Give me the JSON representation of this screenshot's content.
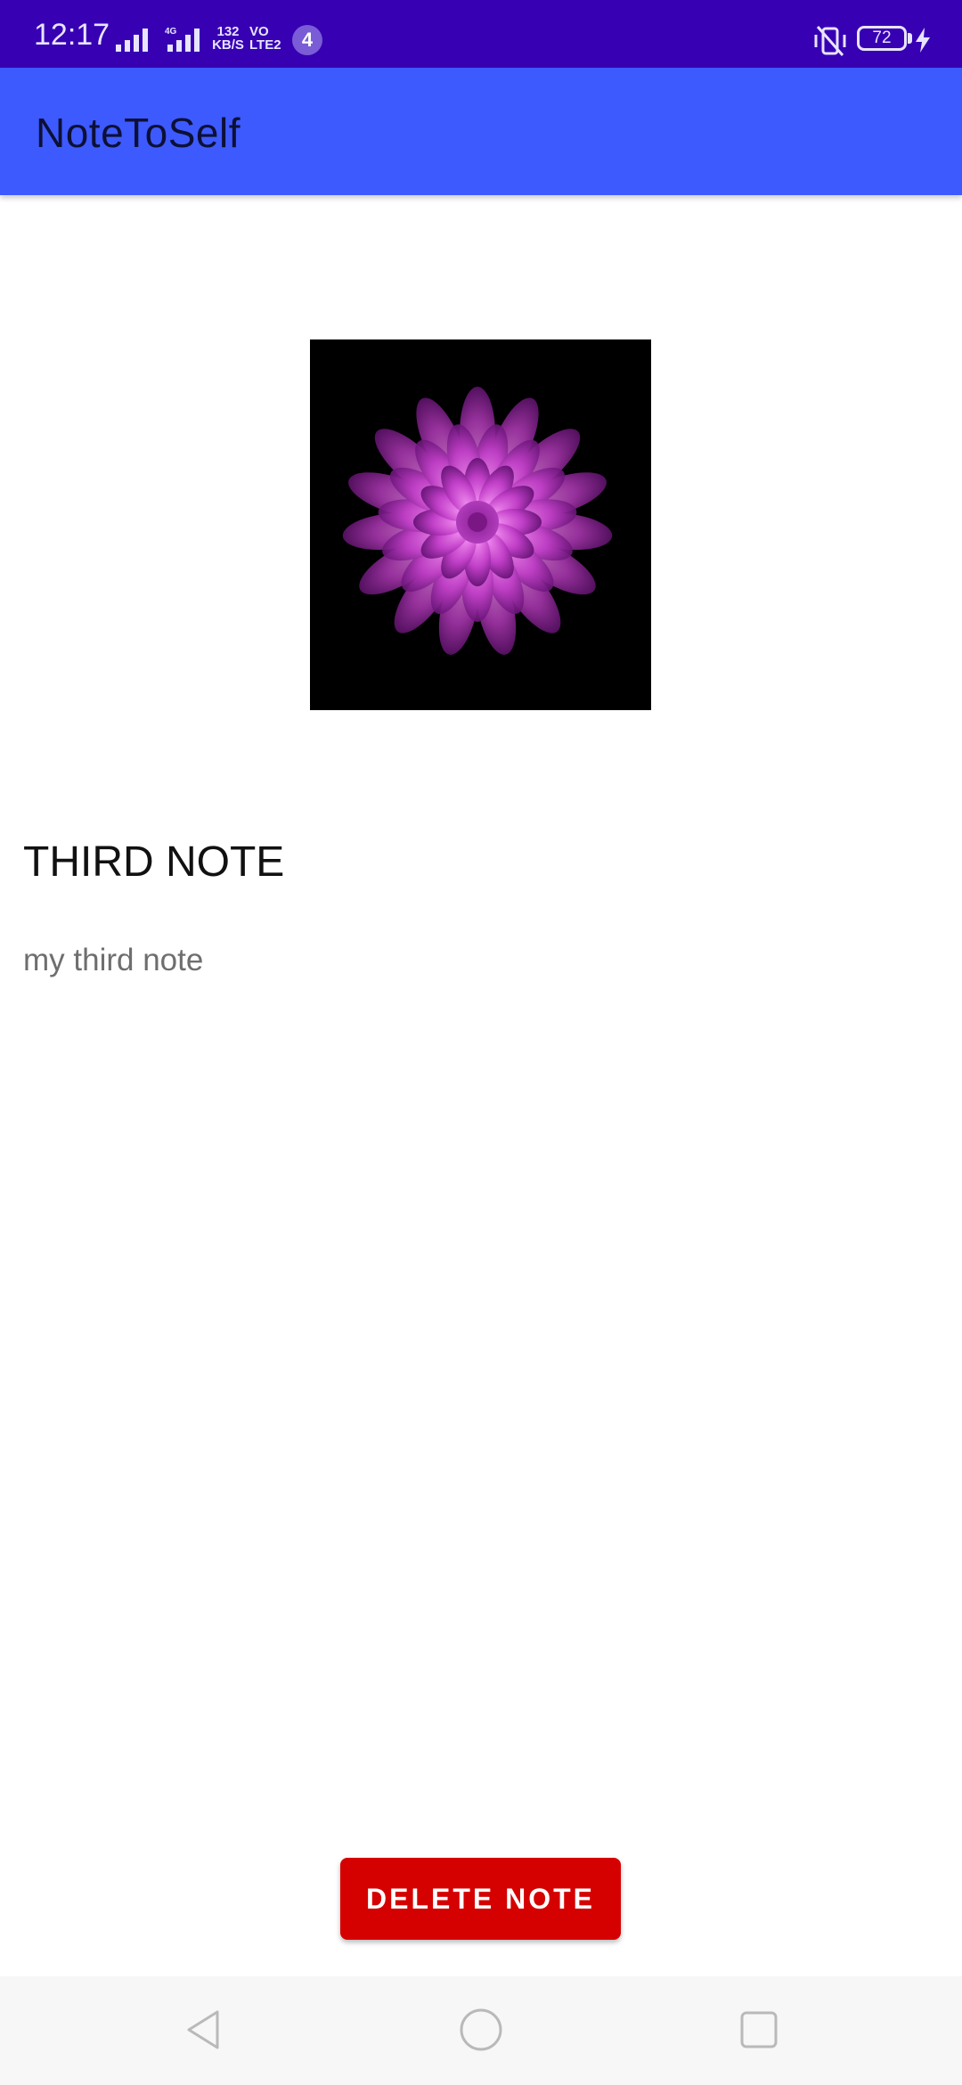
{
  "status_bar": {
    "time": "12:17",
    "network_type": "4G",
    "net_speed_value": "132",
    "net_speed_unit": "KB/S",
    "volte_line1": "VO",
    "volte_line2": "LTE2",
    "notification_count": "4",
    "battery_level": "72",
    "icons": [
      "signal-icon",
      "signal-icon",
      "vibrate-off-icon",
      "battery-icon",
      "charging-icon"
    ]
  },
  "app_bar": {
    "title": "NoteToSelf"
  },
  "note": {
    "image_icon": "flower-image",
    "title": "THIRD NOTE",
    "body": "my third note"
  },
  "actions": {
    "delete_label": "DELETE NOTE"
  },
  "nav_bar": {
    "icons": [
      "back-icon",
      "home-icon",
      "recents-icon"
    ]
  },
  "colors": {
    "status_bar": "#3700b3",
    "app_bar": "#3d5afe",
    "delete_button": "#d50000",
    "flower": "#c13fc8"
  }
}
